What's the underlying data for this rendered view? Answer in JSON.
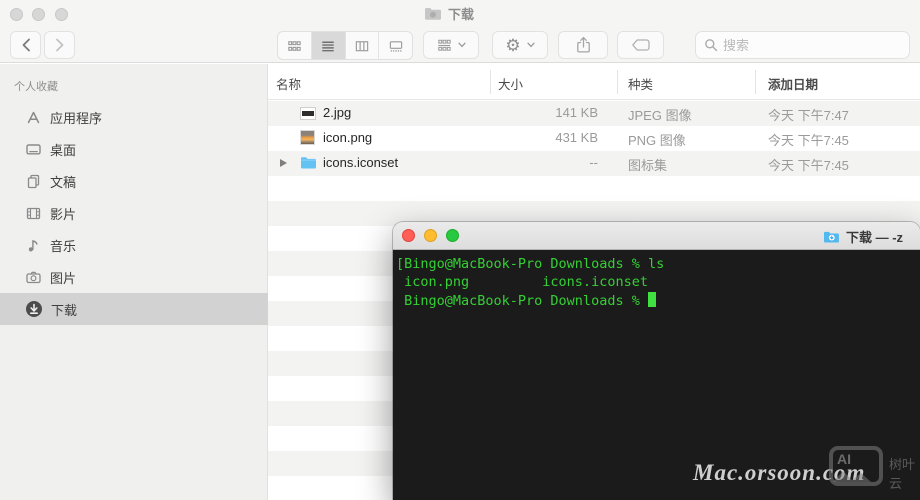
{
  "finder": {
    "title": "下载",
    "toolbar": {
      "search_placeholder": "搜索"
    },
    "sidebar": {
      "section": "个人收藏",
      "items": [
        {
          "label": "应用程序",
          "icon": "app-store-icon"
        },
        {
          "label": "桌面",
          "icon": "desktop-icon"
        },
        {
          "label": "文稿",
          "icon": "documents-icon"
        },
        {
          "label": "影片",
          "icon": "movies-icon"
        },
        {
          "label": "音乐",
          "icon": "music-icon"
        },
        {
          "label": "图片",
          "icon": "pictures-icon"
        },
        {
          "label": "下载",
          "icon": "downloads-icon",
          "selected": true
        }
      ]
    },
    "list": {
      "columns": [
        "名称",
        "大小",
        "种类",
        "添加日期"
      ],
      "sort_column": "添加日期",
      "rows": [
        {
          "name": "2.jpg",
          "size": "141 KB",
          "kind": "JPEG 图像",
          "date_added": "今天 下午7:47",
          "icon": "jpeg-thumbnail",
          "expandable": false
        },
        {
          "name": "icon.png",
          "size": "431 KB",
          "kind": "PNG 图像",
          "date_added": "今天 下午7:45",
          "icon": "png-thumbnail",
          "expandable": false
        },
        {
          "name": "icons.iconset",
          "size": "--",
          "kind": "图标集",
          "date_added": "今天 下午7:45",
          "icon": "blue-folder",
          "expandable": true
        }
      ]
    }
  },
  "terminal": {
    "title": "下载 — -z",
    "lines": [
      "[Bingo@MacBook-Pro Downloads % ls",
      " icon.png         icons.iconset",
      " Bingo@MacBook-Pro Downloads % "
    ]
  },
  "watermark": {
    "text": "Mac.orsoon.com",
    "logo_text": "AI",
    "logo_label": "树叶云"
  },
  "colors": {
    "terminal_green": "#35d035",
    "terminal_bg": "#1b1b1b",
    "folder_blue": "#62c2f2",
    "traffic_red": "#ff5f57",
    "traffic_yellow": "#febc2e",
    "traffic_green": "#28c840",
    "sidebar_selected": "#d2d2d2",
    "stripe_gray": "#f3f3f2"
  }
}
